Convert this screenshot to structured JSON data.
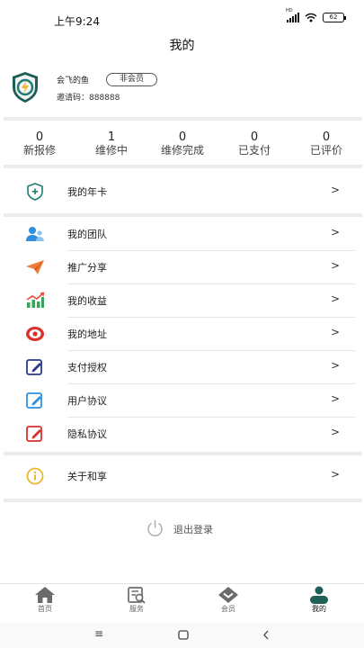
{
  "status_bar": {
    "time": "上午9:24",
    "network": "HD",
    "battery": "62"
  },
  "header": {
    "title": "我的"
  },
  "profile": {
    "nickname": "会飞的鱼",
    "member_badge": "非会员",
    "invite_label": "邀请码：888888"
  },
  "stats": [
    {
      "value": "0",
      "label": "新报修"
    },
    {
      "value": "1",
      "label": "维修中"
    },
    {
      "value": "0",
      "label": "维修完成"
    },
    {
      "value": "0",
      "label": "已支付"
    },
    {
      "value": "0",
      "label": "已评价"
    }
  ],
  "menu": {
    "annual_card": {
      "label": "我的年卡",
      "icon": "shield-plus-icon"
    },
    "team": {
      "label": "我的团队",
      "icon": "team-icon"
    },
    "share": {
      "label": "推广分享",
      "icon": "paper-plane-icon"
    },
    "earnings": {
      "label": "我的收益",
      "icon": "earnings-chart-icon"
    },
    "address": {
      "label": "我的地址",
      "icon": "location-icon"
    },
    "payment_auth": {
      "label": "支付授权",
      "icon": "edit-doc-icon"
    },
    "user_agreement": {
      "label": "用户协议",
      "icon": "edit-doc-icon"
    },
    "privacy": {
      "label": "隐私协议",
      "icon": "edit-doc-icon"
    },
    "about": {
      "label": "关于和享",
      "icon": "info-icon"
    },
    "chevron": ">"
  },
  "logout": {
    "label": "退出登录"
  },
  "tabbar": {
    "home": "首页",
    "service": "服务",
    "member": "会员",
    "mine": "我的"
  },
  "colors": {
    "accent_teal": "#1e7d72",
    "tab_inactive": "#6b6b6b",
    "tab_active": "#1e5f57"
  }
}
